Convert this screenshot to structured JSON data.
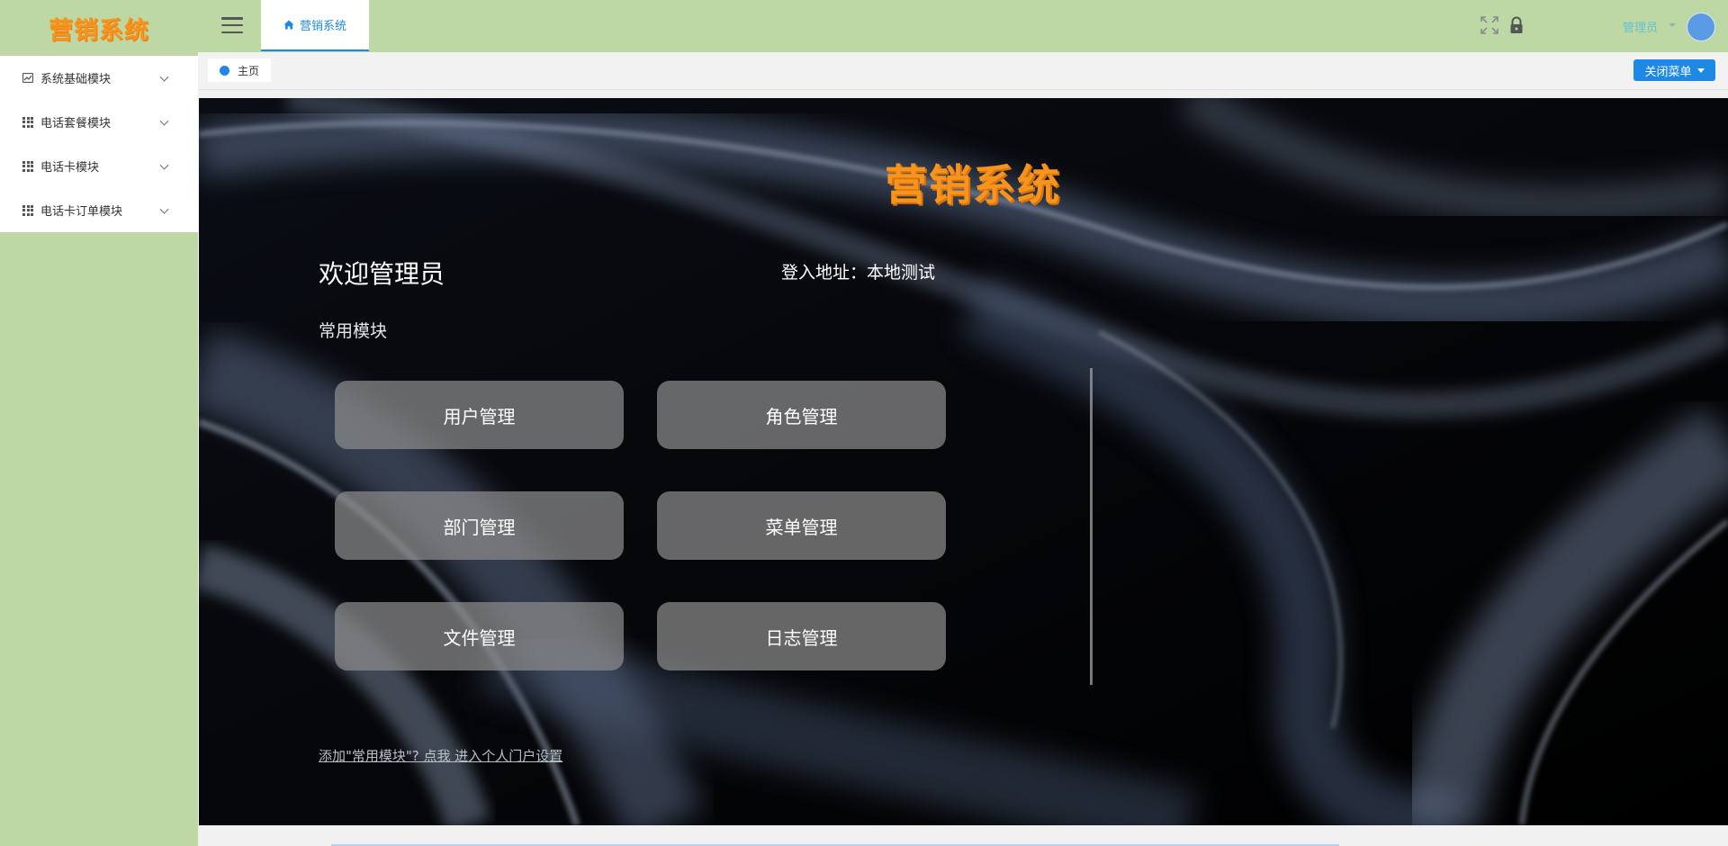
{
  "sidebar": {
    "logo": "营销系统",
    "items": [
      {
        "label": "系统基础模块",
        "icon": "chart-icon"
      },
      {
        "label": "电话套餐模块",
        "icon": "grid-icon"
      },
      {
        "label": "电话卡模块",
        "icon": "grid-icon"
      },
      {
        "label": "电话卡订单模块",
        "icon": "grid-icon"
      }
    ]
  },
  "header": {
    "menu_toggle_icon": "hamburger-icon",
    "active_tab": "营销系统",
    "user_name": "管理员",
    "icons": [
      "fullscreen-icon",
      "lock-icon"
    ]
  },
  "tabstrip": {
    "page_tab": "主页",
    "close_menu": "关闭菜单"
  },
  "dashboard": {
    "logo": "营销系统",
    "welcome": "欢迎管理员",
    "login_address": "登入地址：本地测试",
    "section_title": "常用模块",
    "modules": [
      "用户管理",
      "角色管理",
      "部门管理",
      "菜单管理",
      "文件管理",
      "日志管理"
    ],
    "portal_link": "添加\"常用模块\"? 点我 进入个人门户设置"
  },
  "colors": {
    "header_bg": "#bdd8a4",
    "accent": "#1e88e5",
    "logo_orange": "#f6941d",
    "module_button": "#8c8c8c"
  }
}
